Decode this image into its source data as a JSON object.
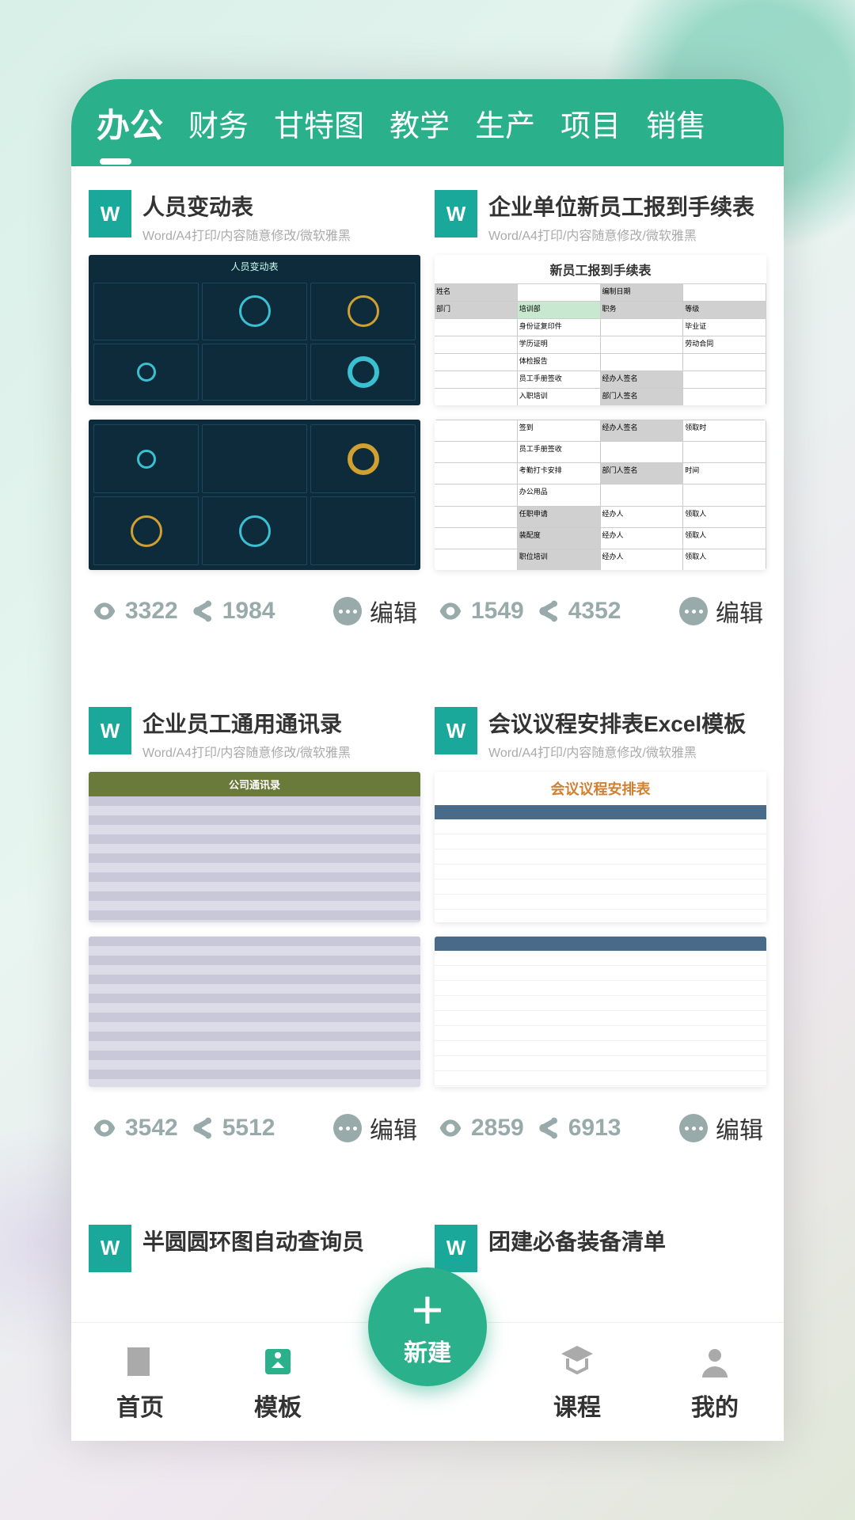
{
  "tabs": [
    "办公",
    "财务",
    "甘特图",
    "教学",
    "生产",
    "项目",
    "销售"
  ],
  "active_tab": 0,
  "cards": [
    {
      "title": "人员变动表",
      "subtitle": "Word/A4打印/内容随意修改/微软雅黑",
      "thumb_type": "dark",
      "thumb_title": "人员变动表",
      "views": "3322",
      "shares": "1984",
      "edit_label": "编辑"
    },
    {
      "title": "企业单位新员工报到手续表",
      "subtitle": "Word/A4打印/内容随意修改/微软雅黑",
      "thumb_type": "table",
      "thumb_title": "新员工报到手续表",
      "views": "1549",
      "shares": "4352",
      "edit_label": "编辑"
    },
    {
      "title": "企业员工通用通讯录",
      "subtitle": "Word/A4打印/内容随意修改/微软雅黑",
      "thumb_type": "olive",
      "thumb_title": "公司通讯录",
      "views": "3542",
      "shares": "5512",
      "edit_label": "编辑"
    },
    {
      "title": "会议议程安排表Excel模板",
      "subtitle": "Word/A4打印/内容随意修改/微软雅黑",
      "thumb_type": "sched",
      "thumb_title": "会议议程安排表",
      "views": "2859",
      "shares": "6913",
      "edit_label": "编辑"
    }
  ],
  "partial_cards": [
    {
      "title": "半圆圆环图自动查询员"
    },
    {
      "title": "团建必备装备清单"
    }
  ],
  "fab_label": "新建",
  "nav": [
    {
      "label": "首页"
    },
    {
      "label": "模板"
    },
    {
      "label": "课程"
    },
    {
      "label": "我的"
    }
  ],
  "active_nav": 1
}
